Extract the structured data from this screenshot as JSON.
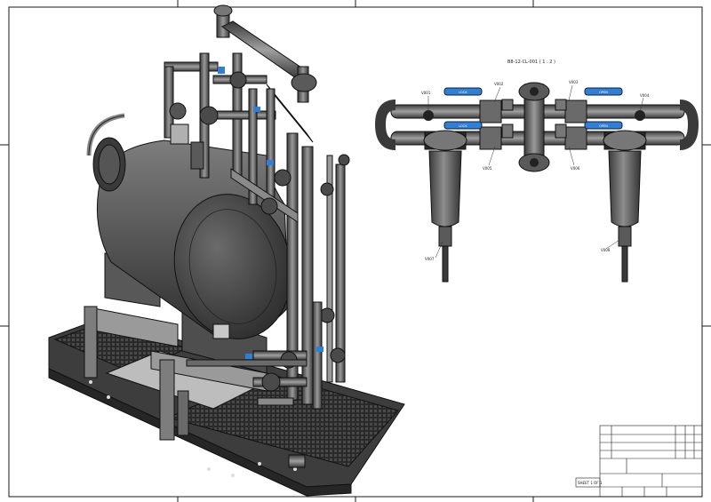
{
  "drawing": {
    "detail_view_label": "B8-12-CL-001 ( 1 : 2 )",
    "sheet_label": "SHEET 1 OF 1",
    "valve_tags": [
      "V001",
      "V002",
      "V003",
      "V004",
      "V005",
      "V006",
      "V007",
      "V008"
    ],
    "handle_labels": [
      "LOCK",
      "OPEN",
      "LOCK",
      "OPEN"
    ],
    "colors": {
      "line": "#1a1a1a",
      "steel": "#4a4a4a",
      "steel_light": "#8a8a8a",
      "handle": "#2f7fd6",
      "frame": "#3a3a3a"
    }
  }
}
